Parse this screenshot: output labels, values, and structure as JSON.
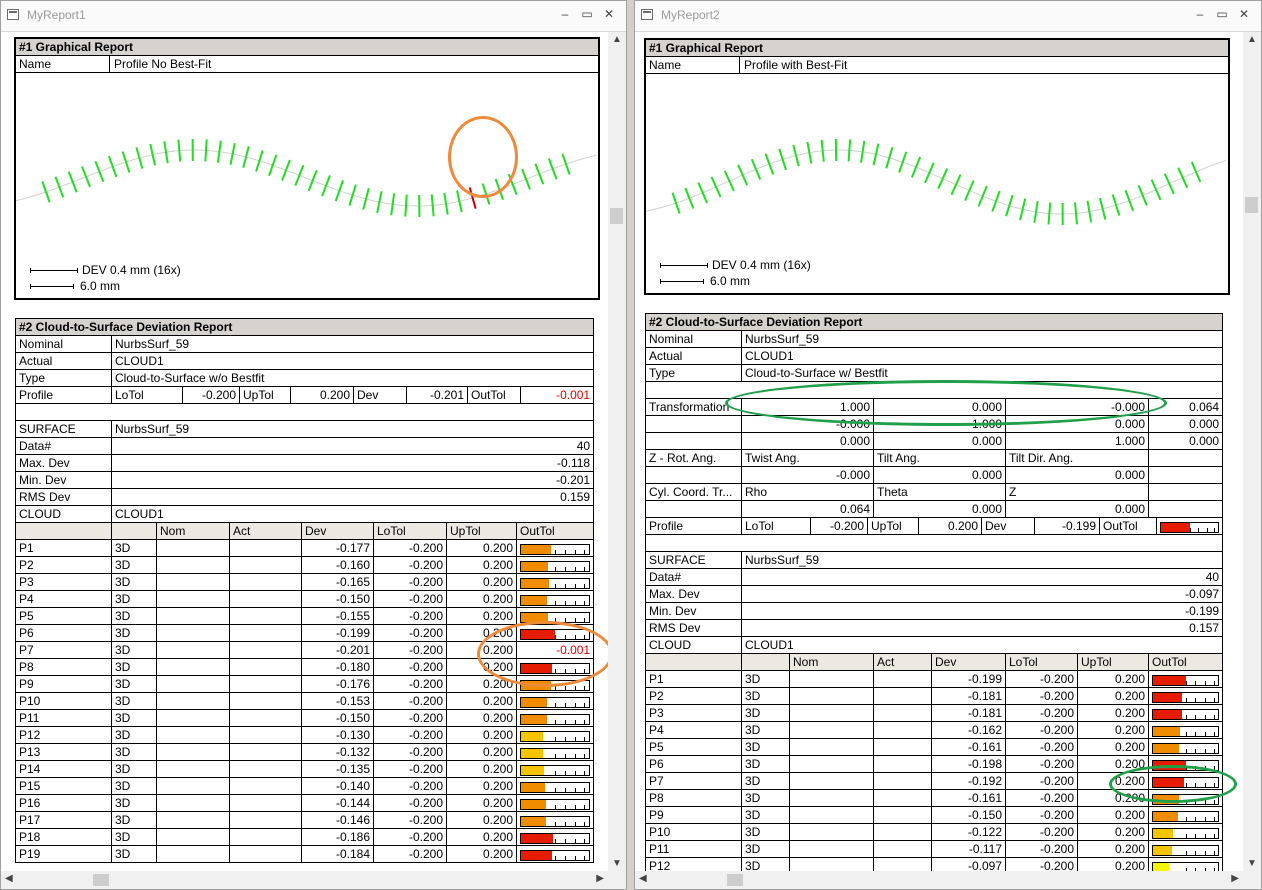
{
  "colors": {
    "orange": "#ee8a3a",
    "green": "#21a04a",
    "tick_ok": "#22dd22",
    "tick_bad": "#cc0000",
    "bar_red": "#e61c00",
    "bar_orange": "#f08c00",
    "bar_yellow": "#f5c400",
    "bar_lightyellow": "#f7f700"
  },
  "windows": [
    {
      "title": "MyReport1",
      "graphical": {
        "heading": "#1  Graphical Report",
        "name_label": "Name",
        "name_value": "Profile No Best-Fit",
        "dev_scale": "DEV 0.4 mm (16x)",
        "len_scale": "6.0 mm"
      },
      "report": {
        "heading": "#2  Cloud-to-Surface Deviation Report",
        "nominal_label": "Nominal",
        "nominal_value": "NurbsSurf_59",
        "actual_label": "Actual",
        "actual_value": "CLOUD1",
        "type_label": "Type",
        "type_value": "Cloud-to-Surface w/o Bestfit",
        "profile_label": "Profile",
        "lotol_label": "LoTol",
        "lotol": "-0.200",
        "uptol_label": "UpTol",
        "uptol": "0.200",
        "dev_label": "Dev",
        "dev": "-0.201",
        "outtol_label": "OutTol",
        "outtol": "-0.001",
        "surface_label": "SURFACE",
        "surface_value": "NurbsSurf_59",
        "data_label": "Data#",
        "data_value": "40",
        "maxdev_label": "Max. Dev",
        "maxdev": "-0.118",
        "mindev_label": "Min.  Dev",
        "mindev": "-0.201",
        "rms_label": "RMS Dev",
        "rms": "0.159",
        "cloud_label": "CLOUD",
        "cloud_value": "CLOUD1",
        "columns": [
          "Nom",
          "Act",
          "Dev",
          "LoTol",
          "UpTol",
          "OutTol"
        ],
        "rows": [
          {
            "p": "P1",
            "t": "3D",
            "dev": "-0.177",
            "lo": "-0.200",
            "up": "0.200",
            "fill": 0.44,
            "color": "orange"
          },
          {
            "p": "P2",
            "t": "3D",
            "dev": "-0.160",
            "lo": "-0.200",
            "up": "0.200",
            "fill": 0.4,
            "color": "orange"
          },
          {
            "p": "P3",
            "t": "3D",
            "dev": "-0.165",
            "lo": "-0.200",
            "up": "0.200",
            "fill": 0.41,
            "color": "orange"
          },
          {
            "p": "P4",
            "t": "3D",
            "dev": "-0.150",
            "lo": "-0.200",
            "up": "0.200",
            "fill": 0.38,
            "color": "orange"
          },
          {
            "p": "P5",
            "t": "3D",
            "dev": "-0.155",
            "lo": "-0.200",
            "up": "0.200",
            "fill": 0.39,
            "color": "orange"
          },
          {
            "p": "P6",
            "t": "3D",
            "dev": "-0.199",
            "lo": "-0.200",
            "up": "0.200",
            "fill": 0.5,
            "color": "red"
          },
          {
            "p": "P7",
            "t": "3D",
            "dev": "-0.201",
            "lo": "-0.200",
            "up": "0.200",
            "out": "-0.001"
          },
          {
            "p": "P8",
            "t": "3D",
            "dev": "-0.180",
            "lo": "-0.200",
            "up": "0.200",
            "fill": 0.45,
            "color": "red"
          },
          {
            "p": "P9",
            "t": "3D",
            "dev": "-0.176",
            "lo": "-0.200",
            "up": "0.200",
            "fill": 0.44,
            "color": "orange"
          },
          {
            "p": "P10",
            "t": "3D",
            "dev": "-0.153",
            "lo": "-0.200",
            "up": "0.200",
            "fill": 0.38,
            "color": "orange"
          },
          {
            "p": "P11",
            "t": "3D",
            "dev": "-0.150",
            "lo": "-0.200",
            "up": "0.200",
            "fill": 0.38,
            "color": "orange"
          },
          {
            "p": "P12",
            "t": "3D",
            "dev": "-0.130",
            "lo": "-0.200",
            "up": "0.200",
            "fill": 0.32,
            "color": "yellow"
          },
          {
            "p": "P13",
            "t": "3D",
            "dev": "-0.132",
            "lo": "-0.200",
            "up": "0.200",
            "fill": 0.33,
            "color": "yellow"
          },
          {
            "p": "P14",
            "t": "3D",
            "dev": "-0.135",
            "lo": "-0.200",
            "up": "0.200",
            "fill": 0.34,
            "color": "yellow"
          },
          {
            "p": "P15",
            "t": "3D",
            "dev": "-0.140",
            "lo": "-0.200",
            "up": "0.200",
            "fill": 0.35,
            "color": "orange"
          },
          {
            "p": "P16",
            "t": "3D",
            "dev": "-0.144",
            "lo": "-0.200",
            "up": "0.200",
            "fill": 0.36,
            "color": "orange"
          },
          {
            "p": "P17",
            "t": "3D",
            "dev": "-0.146",
            "lo": "-0.200",
            "up": "0.200",
            "fill": 0.37,
            "color": "orange"
          },
          {
            "p": "P18",
            "t": "3D",
            "dev": "-0.186",
            "lo": "-0.200",
            "up": "0.200",
            "fill": 0.47,
            "color": "red"
          },
          {
            "p": "P19",
            "t": "3D",
            "dev": "-0.184",
            "lo": "-0.200",
            "up": "0.200",
            "fill": 0.46,
            "color": "red"
          }
        ]
      }
    },
    {
      "title": "MyReport2",
      "graphical": {
        "heading": "#1  Graphical Report",
        "name_label": "Name",
        "name_value": "Profile with Best-Fit",
        "dev_scale": "DEV 0.4 mm (16x)",
        "len_scale": "6.0 mm"
      },
      "report": {
        "heading": "#2  Cloud-to-Surface Deviation Report",
        "nominal_label": "Nominal",
        "nominal_value": "NurbsSurf_59",
        "actual_label": "Actual",
        "actual_value": "CLOUD1",
        "type_label": "Type",
        "type_value": "Cloud-to-Surface w/ Bestfit",
        "transformation_label": "Transformation",
        "matrix": [
          [
            "1.000",
            "0.000",
            "-0.000",
            "0.064"
          ],
          [
            "-0.000",
            "1.000",
            "0.000",
            "0.000"
          ],
          [
            "0.000",
            "0.000",
            "1.000",
            "0.000"
          ]
        ],
        "rot_label": "Z - Rot. Ang.",
        "twist_label": "Twist Ang.",
        "tilt_label": "Tilt Ang.",
        "tiltdir_label": "Tilt Dir. Ang.",
        "twist": "-0.000",
        "tilt": "0.000",
        "tiltdir": "0.000",
        "cyl_label": "Cyl. Coord. Tr...",
        "rho_label": "Rho",
        "theta_label": "Theta",
        "z_label": "Z",
        "rho": "0.064",
        "theta": "0.000",
        "z": "0.000",
        "profile_label": "Profile",
        "lotol_label": "LoTol",
        "lotol": "-0.200",
        "uptol_label": "UpTol",
        "uptol": "0.200",
        "dev_label": "Dev",
        "dev": "-0.199",
        "outtol_label": "OutTol",
        "profile_fill": 0.5,
        "surface_label": "SURFACE",
        "surface_value": "NurbsSurf_59",
        "data_label": "Data#",
        "data_value": "40",
        "maxdev_label": "Max. Dev",
        "maxdev": "-0.097",
        "mindev_label": "Min.  Dev",
        "mindev": "-0.199",
        "rms_label": "RMS Dev",
        "rms": "0.157",
        "cloud_label": "CLOUD",
        "cloud_value": "CLOUD1",
        "columns": [
          "Nom",
          "Act",
          "Dev",
          "LoTol",
          "UpTol",
          "OutTol"
        ],
        "rows": [
          {
            "p": "P1",
            "t": "3D",
            "dev": "-0.199",
            "lo": "-0.200",
            "up": "0.200",
            "fill": 0.5,
            "color": "red"
          },
          {
            "p": "P2",
            "t": "3D",
            "dev": "-0.181",
            "lo": "-0.200",
            "up": "0.200",
            "fill": 0.45,
            "color": "red"
          },
          {
            "p": "P3",
            "t": "3D",
            "dev": "-0.181",
            "lo": "-0.200",
            "up": "0.200",
            "fill": 0.45,
            "color": "red"
          },
          {
            "p": "P4",
            "t": "3D",
            "dev": "-0.162",
            "lo": "-0.200",
            "up": "0.200",
            "fill": 0.41,
            "color": "orange"
          },
          {
            "p": "P5",
            "t": "3D",
            "dev": "-0.161",
            "lo": "-0.200",
            "up": "0.200",
            "fill": 0.4,
            "color": "orange"
          },
          {
            "p": "P6",
            "t": "3D",
            "dev": "-0.198",
            "lo": "-0.200",
            "up": "0.200",
            "fill": 0.5,
            "color": "red"
          },
          {
            "p": "P7",
            "t": "3D",
            "dev": "-0.192",
            "lo": "-0.200",
            "up": "0.200",
            "fill": 0.48,
            "color": "red"
          },
          {
            "p": "P8",
            "t": "3D",
            "dev": "-0.161",
            "lo": "-0.200",
            "up": "0.200",
            "fill": 0.4,
            "color": "orange"
          },
          {
            "p": "P9",
            "t": "3D",
            "dev": "-0.150",
            "lo": "-0.200",
            "up": "0.200",
            "fill": 0.38,
            "color": "orange"
          },
          {
            "p": "P10",
            "t": "3D",
            "dev": "-0.122",
            "lo": "-0.200",
            "up": "0.200",
            "fill": 0.31,
            "color": "yellow"
          },
          {
            "p": "P11",
            "t": "3D",
            "dev": "-0.117",
            "lo": "-0.200",
            "up": "0.200",
            "fill": 0.29,
            "color": "yellow"
          },
          {
            "p": "P12",
            "t": "3D",
            "dev": "-0.097",
            "lo": "-0.200",
            "up": "0.200",
            "fill": 0.24,
            "color": "lightyellow"
          }
        ]
      }
    }
  ],
  "profile_points_window1": [
    {
      "c": "ok"
    },
    {
      "c": "ok"
    },
    {
      "c": "ok"
    },
    {
      "c": "ok"
    },
    {
      "c": "ok"
    },
    {
      "c": "ok"
    },
    {
      "c": "ok"
    },
    {
      "c": "ok"
    },
    {
      "c": "ok"
    },
    {
      "c": "ok"
    },
    {
      "c": "ok"
    },
    {
      "c": "ok"
    },
    {
      "c": "ok"
    },
    {
      "c": "ok"
    },
    {
      "c": "ok"
    },
    {
      "c": "ok"
    },
    {
      "c": "ok"
    },
    {
      "c": "ok"
    },
    {
      "c": "ok"
    },
    {
      "c": "ok"
    },
    {
      "c": "ok"
    },
    {
      "c": "ok"
    },
    {
      "c": "ok"
    },
    {
      "c": "ok"
    },
    {
      "c": "ok"
    },
    {
      "c": "ok"
    },
    {
      "c": "ok"
    },
    {
      "c": "ok"
    },
    {
      "c": "ok"
    },
    {
      "c": "ok"
    },
    {
      "c": "ok"
    },
    {
      "c": "ok"
    },
    {
      "c": "bad"
    },
    {
      "c": "ok"
    },
    {
      "c": "ok"
    },
    {
      "c": "ok"
    },
    {
      "c": "ok"
    },
    {
      "c": "ok"
    },
    {
      "c": "ok"
    },
    {
      "c": "ok"
    }
  ]
}
